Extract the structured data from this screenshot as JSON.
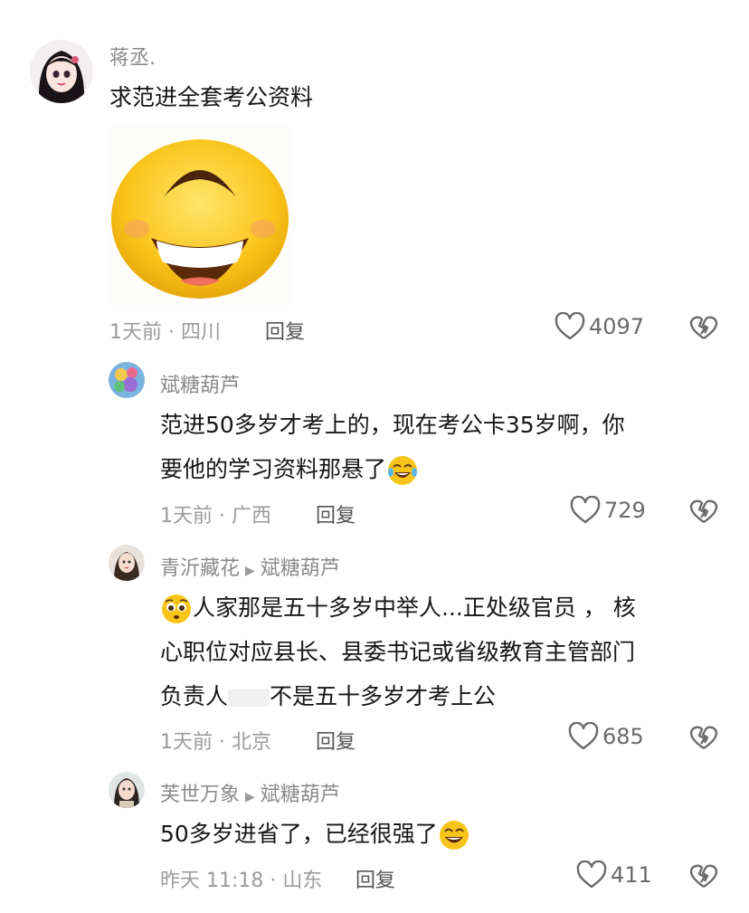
{
  "comments": [
    {
      "username": "蒋丞.",
      "text": "求范进全套考公资料",
      "sticker": "laughing-face-sticker",
      "time": "1天前",
      "location": "四川",
      "reply_label": "回复",
      "likes": "4097"
    },
    {
      "username": "斌糖葫芦",
      "text_line1": "范进50多岁才考上的，现在考公卡35岁啊，你",
      "text_line2": "要他的学习资料那悬了",
      "inline_emoji": "tears-of-joy-emoji",
      "time": "1天前",
      "location": "广西",
      "reply_label": "回复",
      "likes": "729"
    },
    {
      "username": "青沂藏花",
      "reply_to": "斌糖葫芦",
      "leading_emoji": "pleading-face-emoji",
      "text_line1": "人家那是五十多岁中举人...正处级官员 ， 核",
      "text_line2": "心职位对应县长、县委书记或省级教育主管部门",
      "text_line3a": "负责人",
      "text_line3b": "不是五十多岁才考上公",
      "time": "1天前",
      "location": "北京",
      "reply_label": "回复",
      "likes": "685"
    },
    {
      "username": "芙世万象",
      "reply_to": "斌糖葫芦",
      "text": "50多岁进省了，已经很强了",
      "inline_emoji": "grinning-face-emoji",
      "time": "昨天 11:18",
      "location": "山东",
      "reply_label": "回复",
      "likes": "411"
    }
  ],
  "meta_separator": " · ",
  "colors": {
    "text": "#161616",
    "secondary": "#8a8a8a",
    "sticker_yellow": "#f5c518"
  }
}
